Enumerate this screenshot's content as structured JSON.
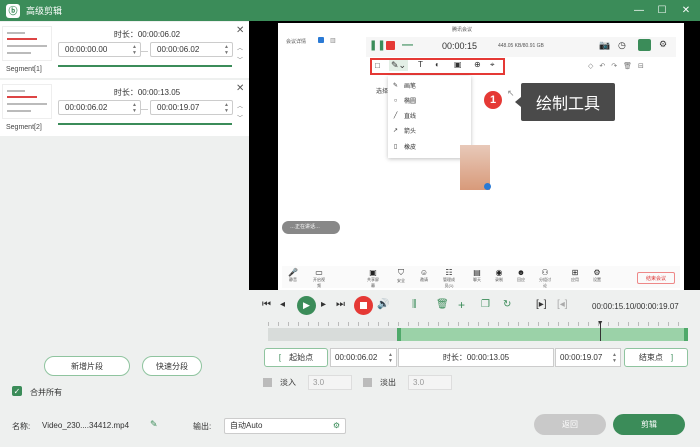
{
  "window": {
    "title": "高级剪辑"
  },
  "segments": [
    {
      "name": "Segment[1]",
      "duration_label": "时长：",
      "duration": "00:00:06.02",
      "start": "00:00:00.00",
      "end": "00:00:06.02",
      "dash": "—"
    },
    {
      "name": "Segment[2]",
      "duration_label": "时长：",
      "duration": "00:00:13.05",
      "start": "00:00:06.02",
      "end": "00:00:19.07",
      "dash": "—"
    }
  ],
  "left_actions": {
    "add_segment": "新增片段",
    "quick_split": "快速分段",
    "merge_all": "合并所有"
  },
  "preview": {
    "meeting_app_title": "腾讯会议",
    "meeting_timer": "00:00:15",
    "meeting_net": "448.05 KB/80.91 GB",
    "meeting_side_label": "选择",
    "drawing_menu": [
      "画笔",
      "椭圆",
      "直线",
      "箭头",
      "橡皮"
    ],
    "callout_number": "1",
    "callout_text": "绘制工具",
    "meeting_top_left": "会议详情",
    "meeting_bottom_note": "…正在讲话…",
    "end_meeting": "结束会议",
    "bottom_buttons": [
      "静音",
      "开启视频",
      "共享屏幕",
      "安全",
      "邀请",
      "管理成员(1)",
      "聊天",
      "录制",
      "回应",
      "分组讨论",
      "应用",
      "设置"
    ]
  },
  "player": {
    "time": "00:00:15.10/00:00:19.07"
  },
  "trim": {
    "start_label": "起始点",
    "start_value": "00:00:06.02",
    "duration_label": "时长：",
    "duration_value": "00:00:13.05",
    "end_value": "00:00:19.07",
    "end_label": "结束点",
    "progress": 0.79
  },
  "fade": {
    "in_label": "淡入",
    "in_value": "3.0",
    "out_label": "淡出",
    "out_value": "3.0"
  },
  "footer": {
    "name_label": "名称:",
    "filename": "Video_230....34412.mp4",
    "output_label": "输出:",
    "output_value": "自动Auto",
    "back": "返回",
    "clip": "剪辑"
  },
  "colors": {
    "brand": "#3b8c59",
    "highlight": "#e53935",
    "selection": "#9bd2a8"
  }
}
